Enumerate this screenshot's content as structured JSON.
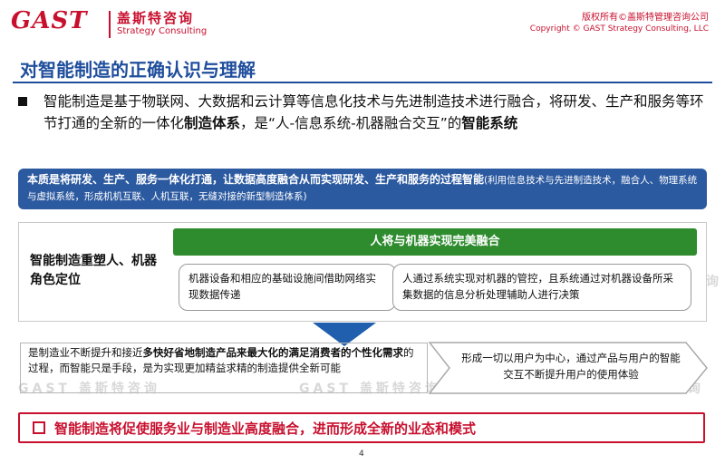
{
  "header": {
    "logo_mark": "GAST",
    "logo_cn": "盖斯特咨询",
    "logo_en": "Strategy Consulting",
    "copyright_cn": "版权所有©盖斯特管理咨询公司",
    "copyright_en": "Copyright © GAST Strategy Consulting, LLC"
  },
  "title": "对智能制造的正确认识与理解",
  "intro": {
    "part1": "智能制造是基于物联网、大数据和云计算等信息化技术与先进制造技术进行融合，将研发、生产和服务等环节打通的全新的一体化",
    "bold1": "制造体系",
    "part2": "，是“人-信息系统-机器融合交互”的",
    "bold2": "智能系统"
  },
  "essence": {
    "main": "本质是将研发、生产、服务一体化打通，让数据高度融合从而实现研发、生产和服务的过程智能",
    "note": "(利用信息技术与先进制造技术，融合人、物理系统与虚拟系统，形成机机互联、人机互联，无缝对接的新型制造体系)"
  },
  "roles": {
    "label": "智能制造重塑人、机器角色定位",
    "bar": "人将与机器实现完美融合",
    "card1": "机器设备和相应的基础设施间借助网络实现数据传递",
    "card2": "人通过系统实现对机器的管控，且系统通过对机器设备所采集数据的信息分析处理辅助人进行决策"
  },
  "bottom": {
    "left_a": "是制造业不断提升和接近",
    "left_bold": "多快好省地制造产品来最大化的满足消费者的个性化需求",
    "left_b": "的过程，而智能只是手段，是为实现更加精益求精的制造提供全新可能",
    "right": "形成一切以用户为中心，通过产品与用户的智能交互不断提升用户的使用体验"
  },
  "conclusion": "智能制造将促使服务业与制造业高度融合，进而形成全新的业态和模式",
  "page_number": "4",
  "watermark": "GAST 盖斯特咨询",
  "colors": {
    "brand_red": "#c8102e",
    "title_blue": "#1f4e9c",
    "essence_blue": "#2c5aa0",
    "bar_green": "#2e8b2e"
  }
}
